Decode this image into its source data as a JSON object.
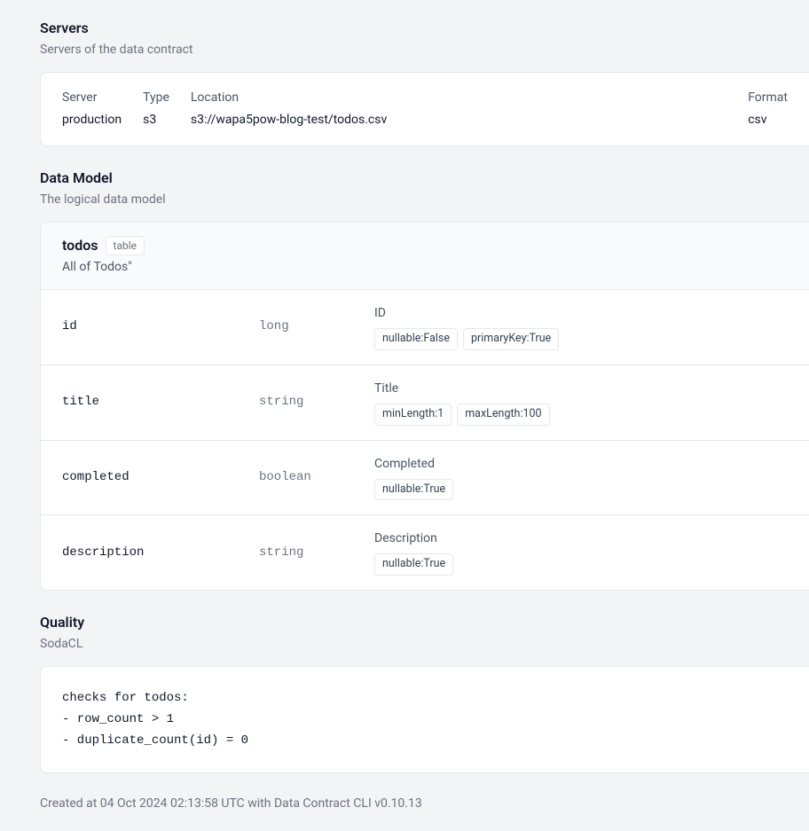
{
  "servers": {
    "title": "Servers",
    "subtitle": "Servers of the data contract",
    "headers": {
      "server": "Server",
      "type": "Type",
      "location": "Location",
      "format": "Format"
    },
    "row": {
      "server": "production",
      "type": "s3",
      "location": "s3://wapa5pow-blog-test/todos.csv",
      "format": "csv"
    }
  },
  "dataModel": {
    "title": "Data Model",
    "subtitle": "The logical data model",
    "modelName": "todos",
    "typeBadge": "table",
    "modelDesc": "All of Todos\"",
    "fields": [
      {
        "name": "id",
        "type": "long",
        "label": "ID",
        "tags": [
          "nullable:False",
          "primaryKey:True"
        ]
      },
      {
        "name": "title",
        "type": "string",
        "label": "Title",
        "tags": [
          "minLength:1",
          "maxLength:100"
        ]
      },
      {
        "name": "completed",
        "type": "boolean",
        "label": "Completed",
        "tags": [
          "nullable:True"
        ]
      },
      {
        "name": "description",
        "type": "string",
        "label": "Description",
        "tags": [
          "nullable:True"
        ]
      }
    ]
  },
  "quality": {
    "title": "Quality",
    "subtitle": "SodaCL",
    "code": "checks for todos:\n- row_count > 1\n- duplicate_count(id) = 0"
  },
  "footer": "Created at 04 Oct 2024 02:13:58 UTC with Data Contract CLI v0.10.13"
}
